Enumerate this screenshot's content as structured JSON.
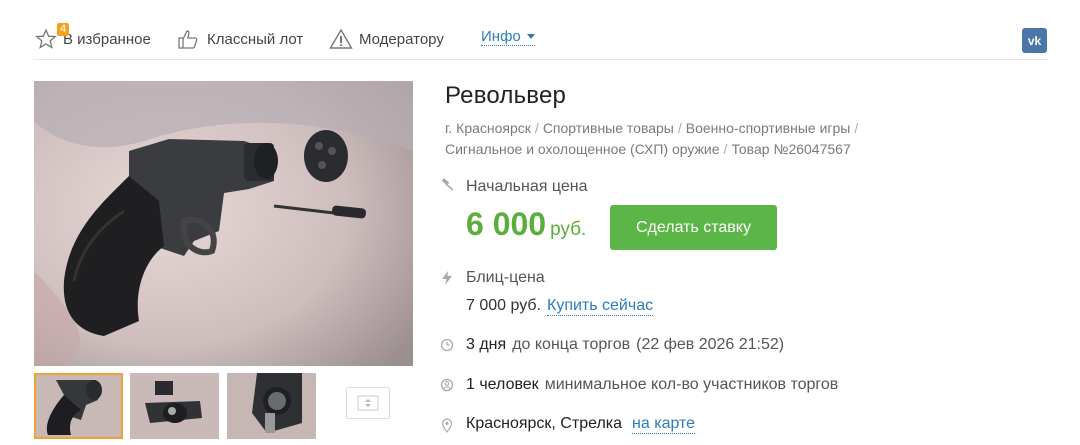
{
  "topbar": {
    "favorites_count": "4",
    "favorites_label": "В избранное",
    "classy_label": "Классный лот",
    "moderator_label": "Модератору",
    "info_label": "Инфо",
    "vk_label": "vk"
  },
  "lot": {
    "title": "Револьвер",
    "breadcrumbs": [
      "г. Красноярск",
      "Спортивные товары",
      "Военно-спортивные игры",
      "Сигнальное и охолощенное (СХП) оружие",
      "Товар №26047567"
    ],
    "start_price_label": "Начальная цена",
    "start_price_value": "6 000",
    "currency": "руб.",
    "bid_button": "Сделать ставку",
    "blitz_label": "Блиц-цена",
    "blitz_price": "7 000 руб.",
    "buy_now": "Купить сейчас",
    "time_left": "3 дня",
    "time_suffix": "до конца торгов",
    "end_date": "(22 фев 2026 21:52)",
    "participants": "1 человек",
    "participants_suffix": "минимальное кол-во участников торгов",
    "location": "Красноярск, Стрелка",
    "map_link": "на карте"
  },
  "colors": {
    "accent_green": "#5cb647",
    "price_green": "#5cae3c",
    "link_blue": "#2a7cbb",
    "badge_orange": "#f4a21e",
    "vk_blue": "#4a76a8"
  },
  "icons": [
    "star-icon",
    "thumbs-up-icon",
    "warning-icon",
    "chevron-down-icon",
    "vk-icon",
    "gavel-icon",
    "lightning-icon",
    "clock-icon",
    "user-icon",
    "location-pin-icon",
    "more-photos-icon"
  ]
}
